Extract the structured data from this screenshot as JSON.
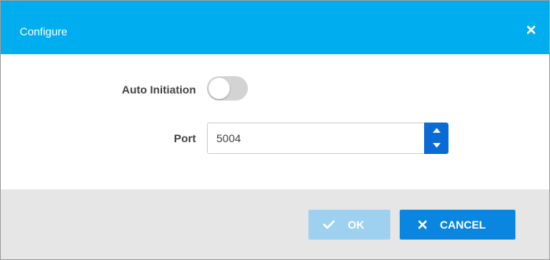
{
  "dialog": {
    "title": "Configure",
    "close_icon": "close-icon"
  },
  "form": {
    "auto_initiation_label": "Auto Initiation",
    "auto_initiation_enabled": false,
    "port_label": "Port",
    "port_value": "5004"
  },
  "footer": {
    "ok_label": "OK",
    "ok_icon": "check-icon",
    "ok_enabled": false,
    "cancel_label": "CANCEL",
    "cancel_icon": "close-icon"
  },
  "colors": {
    "header": "#00aeef",
    "primary_button": "#0a86e0",
    "disabled_button": "#9ed1ef",
    "spinner": "#0a6bd6",
    "footer_bg": "#e6e6e6"
  }
}
